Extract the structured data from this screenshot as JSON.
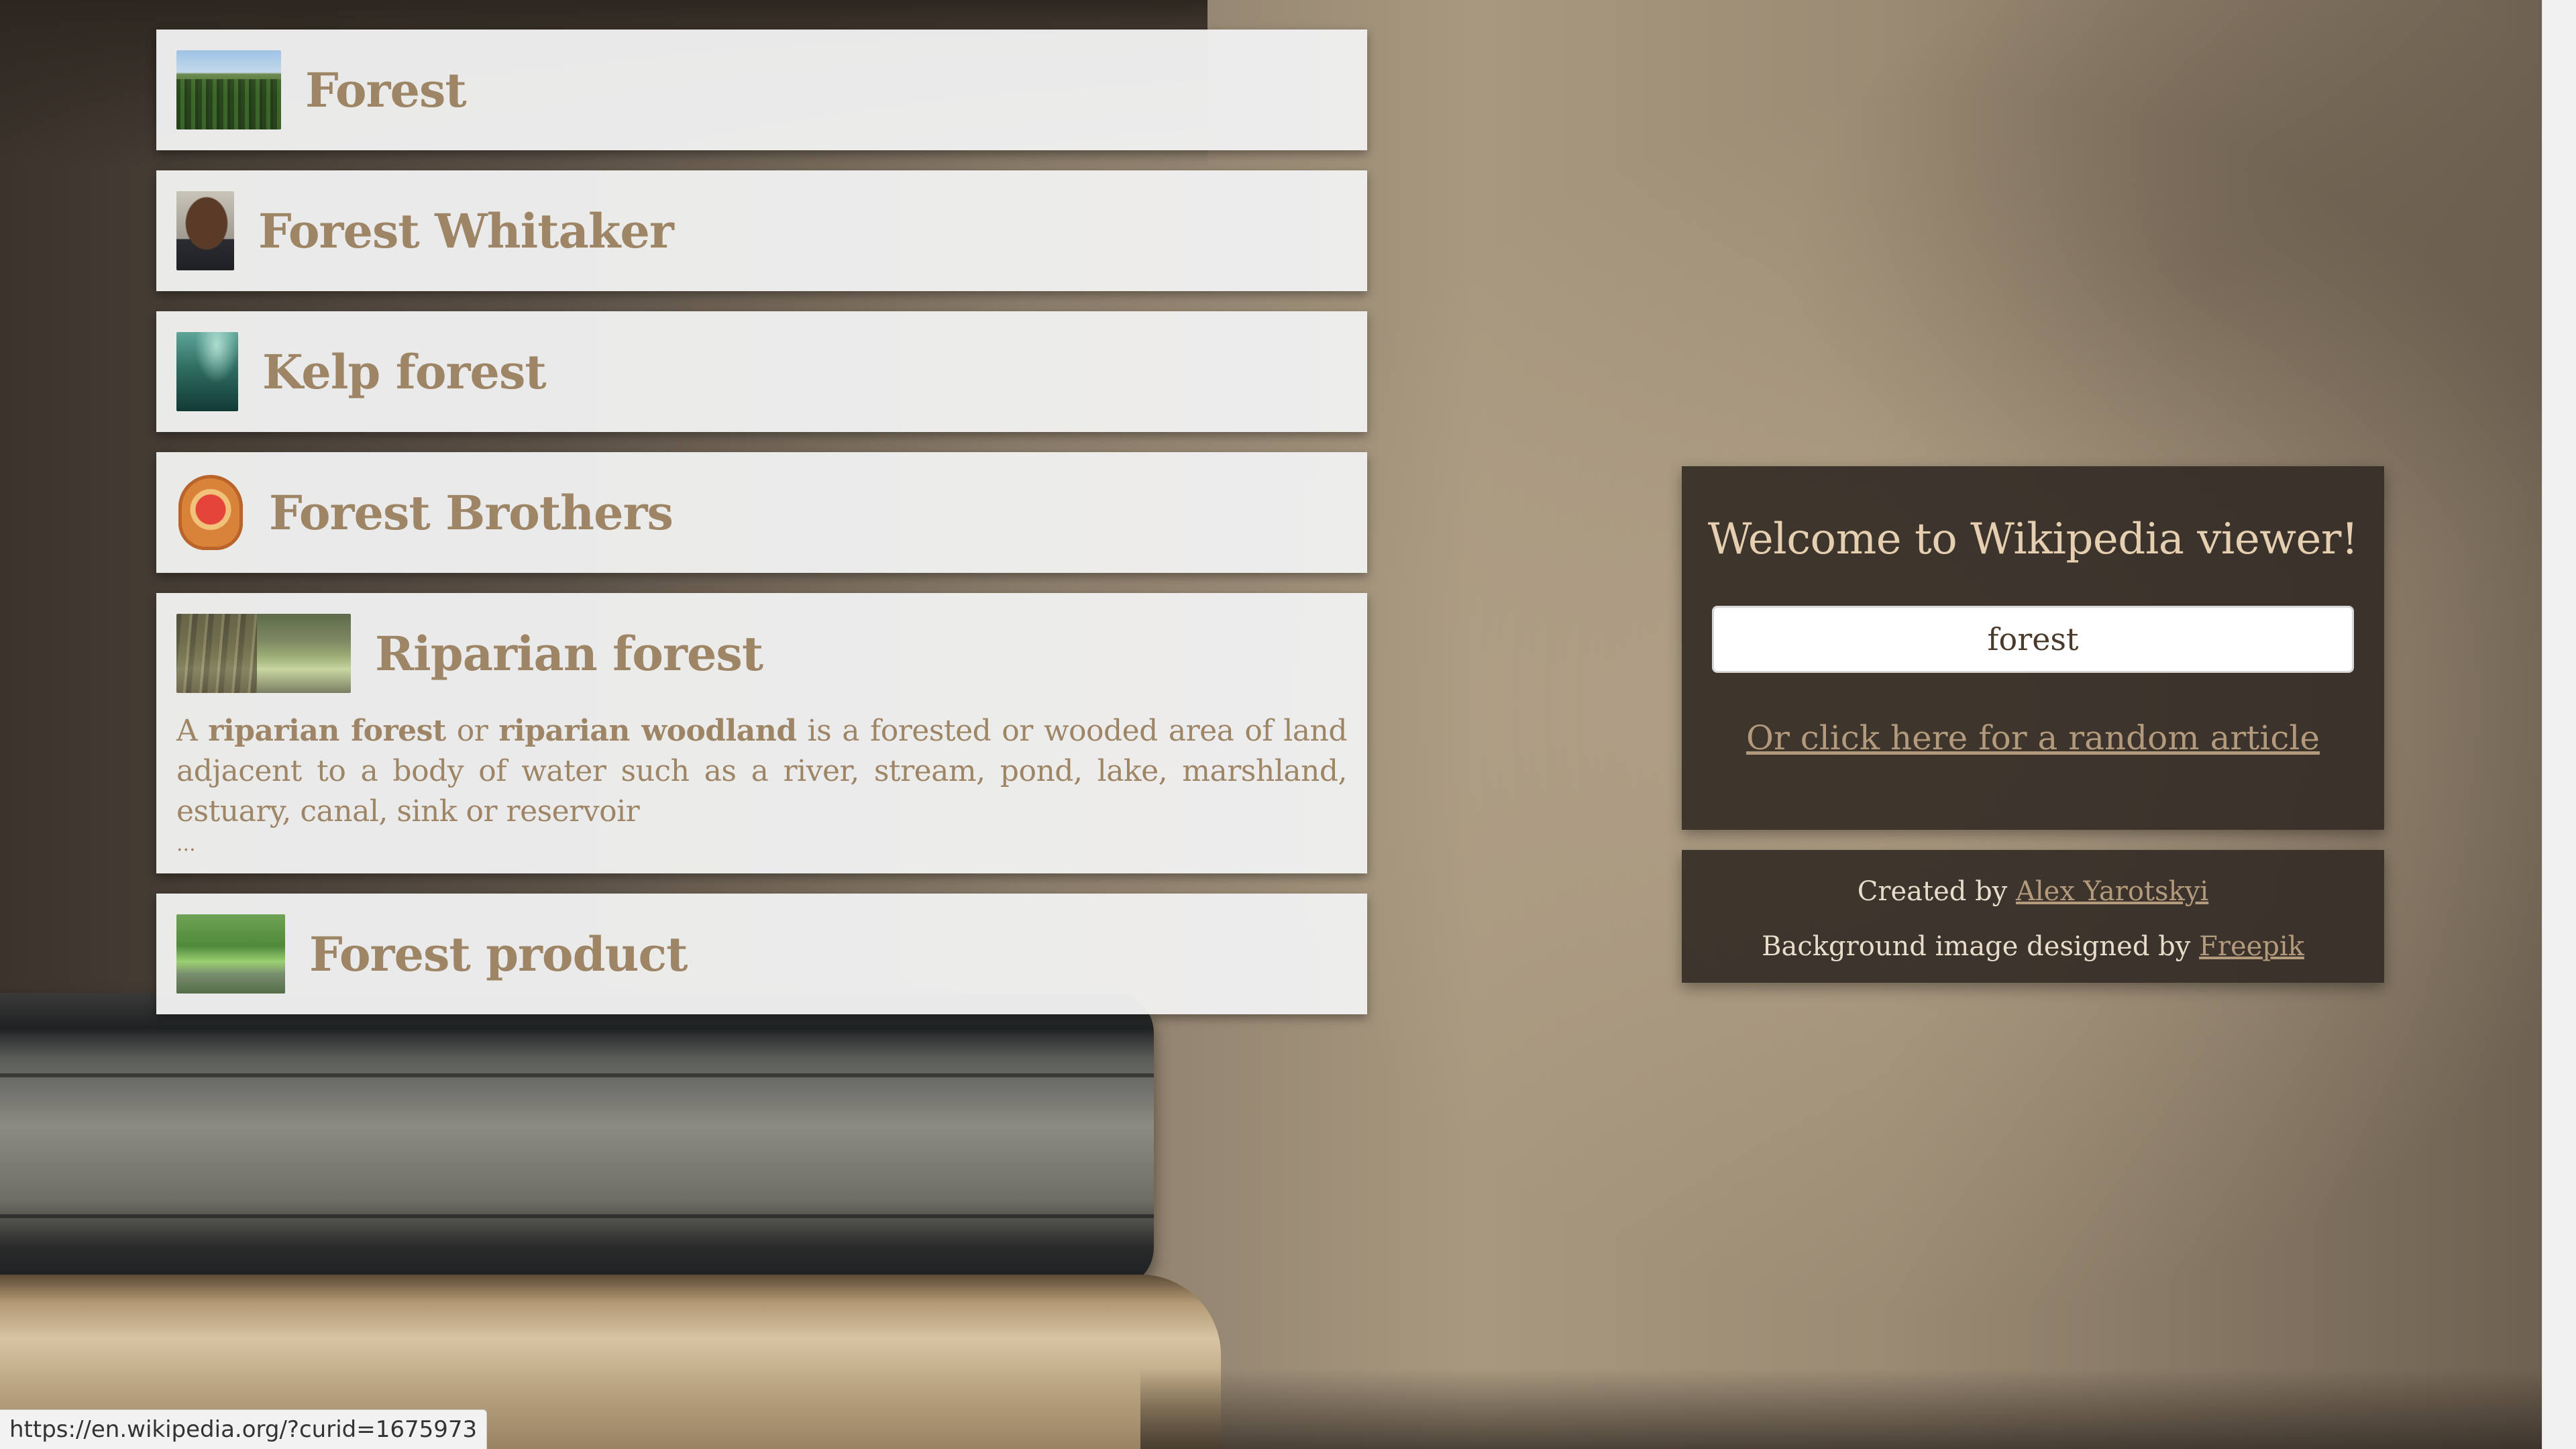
{
  "results": [
    {
      "title": "Forest",
      "thumbnail": "forest-photo-thumbnail"
    },
    {
      "title": "Forest Whitaker",
      "thumbnail": "portrait-photo-thumbnail"
    },
    {
      "title": "Kelp forest",
      "thumbnail": "underwater-kelp-thumbnail"
    },
    {
      "title": "Forest Brothers",
      "thumbnail": "emblem-thumbnail"
    },
    {
      "title": "Riparian forest",
      "thumbnail": "riverside-forest-thumbnail",
      "extract": {
        "p1": "A ",
        "b1": "riparian forest",
        "p2": " or ",
        "b2": "riparian woodland",
        "p3": " is a forested or wooded area of land adjacent to a body of water such as a river, stream, pond, lake, marshland, estuary, canal, sink or reservoir",
        "ellipsis": "..."
      }
    },
    {
      "title": "Forest product",
      "thumbnail": "forest-path-thumbnail"
    }
  ],
  "welcome": {
    "title": "Welcome to Wikipedia viewer!",
    "search_value": "forest",
    "random_link": "Or click here for a random article"
  },
  "credits": {
    "created_prefix": "Created by ",
    "author": "Alex Yarotskyi",
    "bg_prefix": "Background image designed by ",
    "bg_author": "Freepik"
  },
  "statusbar": {
    "url": "https://en.wikipedia.org/?curid=1675973"
  },
  "colors": {
    "title_text": "#9e8566",
    "panel_bg": "#342d26",
    "link": "#b39a7c"
  }
}
